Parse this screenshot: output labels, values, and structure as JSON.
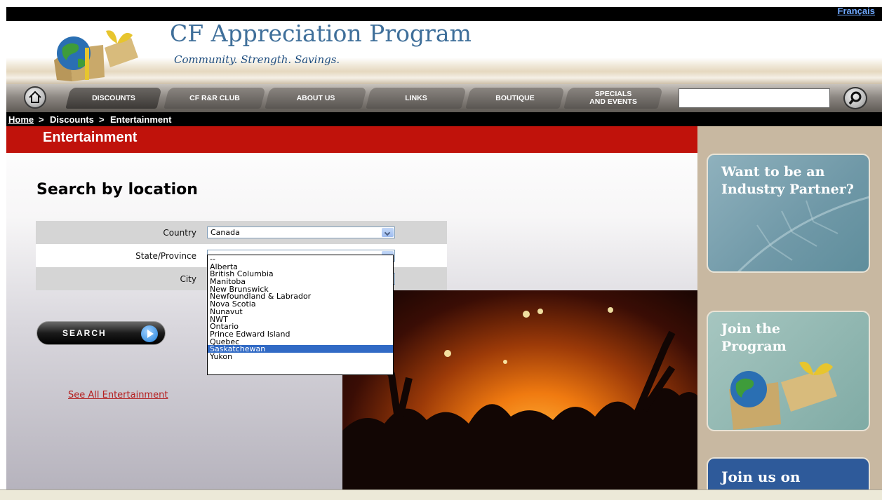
{
  "header": {
    "language_link": "Français",
    "site_title": "CF Appreciation Program",
    "tagline": "Community. Strength. Savings."
  },
  "nav": {
    "items": [
      {
        "label": "DISCOUNTS"
      },
      {
        "label": "CF R&R CLUB"
      },
      {
        "label": "ABOUT US"
      },
      {
        "label": "LINKS"
      },
      {
        "label": "BOUTIQUE"
      },
      {
        "label": "SPECIALS\nAND EVENTS"
      }
    ],
    "search_value": ""
  },
  "breadcrumb": {
    "home": "Home",
    "sep": ">",
    "discounts": "Discounts",
    "current": "Entertainment"
  },
  "section": {
    "title": "Entertainment"
  },
  "search_form": {
    "heading": "Search by location",
    "country_label": "Country",
    "country_value": "Canada",
    "province_label": "State/Province",
    "province_value": "--",
    "city_label": "City",
    "province_options": [
      "--",
      "Alberta",
      "British Columbia",
      "Manitoba",
      "New Brunswick",
      "Newfoundland & Labrador",
      "Nova Scotia",
      "Nunavut",
      "NWT",
      "Ontario",
      "Prince Edward Island",
      "Quebec",
      "Saskatchewan",
      "Yukon"
    ],
    "highlighted_option": "Saskatchewan",
    "search_button": "SEARCH",
    "see_all_link": "See All Entertainment"
  },
  "sidebar": {
    "partner_promo": "Want to be an Industry Partner?",
    "join_promo": "Join the Program",
    "social_promo": "Join us on"
  },
  "colors": {
    "section_header": "#c0120b",
    "title_blue": "#3f6f9a",
    "sidebar_bg": "#c8b8a1",
    "dropdown_highlight": "#316ac5"
  }
}
